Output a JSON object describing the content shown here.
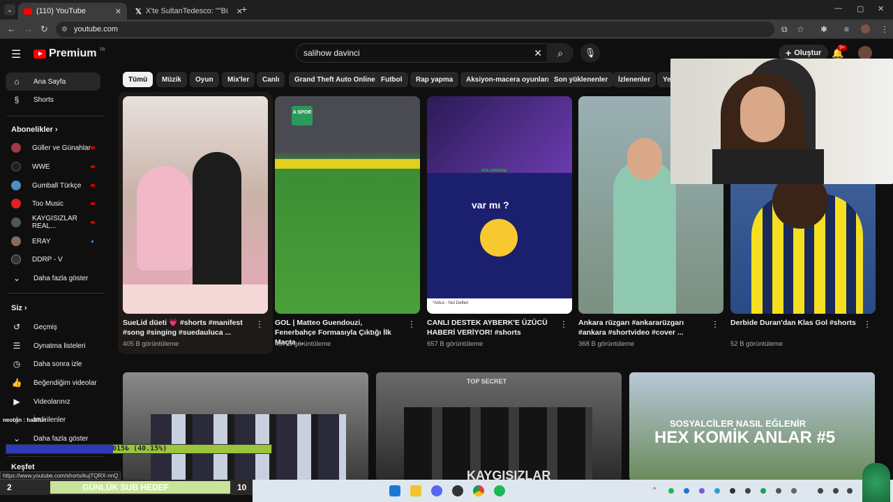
{
  "browser": {
    "tabs": [
      {
        "title": "(110) YouTube",
        "active": true
      },
      {
        "title": "X'te SultanTedesco: \"\"Bütün Fe",
        "active": false
      }
    ],
    "url": "youtube.com",
    "status_url": "https://www.youtube.com/shorts/kujTQRX-nnQ"
  },
  "header": {
    "brand": "Premium",
    "country": "TR",
    "search_value": "salihow davinci",
    "create_label": "Oluştur",
    "notification_count": "9+"
  },
  "sidebar": {
    "main": [
      {
        "label": "Ana Sayfa",
        "icon": "home-icon",
        "active": true
      },
      {
        "label": "Shorts",
        "icon": "shorts-icon",
        "active": false
      }
    ],
    "subs_heading": "Abonelikler",
    "subs": [
      {
        "label": "Güller ve Günahlar",
        "color": "#a0384a",
        "badge": "live"
      },
      {
        "label": "WWE",
        "color": "#222222",
        "badge": "live"
      },
      {
        "label": "Gumball Türkçe",
        "color": "#4a90c8",
        "badge": "live"
      },
      {
        "label": "Too Music",
        "color": "#e02020",
        "badge": "live"
      },
      {
        "label": "KAYGISIZLAR REAL...",
        "color": "#555555",
        "badge": "live"
      },
      {
        "label": "ERAY",
        "color": "#8a6a5a",
        "badge": "new"
      },
      {
        "label": "DDRP - V",
        "color": "#333333",
        "badge": ""
      }
    ],
    "show_more": "Daha fazla göster",
    "you_heading": "Siz",
    "you": [
      {
        "label": "Geçmiş",
        "icon": "history-icon"
      },
      {
        "label": "Oynatma listeleri",
        "icon": "playlist-icon"
      },
      {
        "label": "Daha sonra izle",
        "icon": "watch-later-icon"
      },
      {
        "label": "Beğendiğim videolar",
        "icon": "like-icon"
      },
      {
        "label": "Videolarınız",
        "icon": "your-videos-icon"
      },
      {
        "label": "İndirilenler",
        "icon": "download-icon"
      }
    ],
    "show_more_2": "Daha fazla göster",
    "explore_heading": "Keşfet"
  },
  "chips": [
    "Tümü",
    "Müzik",
    "Oyun",
    "Mix'ler",
    "Canlı",
    "Grand Theft Auto Online",
    "Futbol",
    "Rap yapma",
    "Aksiyon-macera oyunları",
    "Son yüklenenler",
    "İzlenenler",
    "Ye"
  ],
  "videos": [
    {
      "title": "SueLid düeti 💗 #shorts #manifest #song #singing #suedauluca ...",
      "views": "405 B görüntüleme",
      "bg": "#c9b3a8"
    },
    {
      "title": "GOL | Matteo Guendouzi, Fenerbahçe Formasıyla Çıktığı İlk Maçta ...",
      "views": "457 B görüntüleme",
      "bg": "#3d7a34"
    },
    {
      "title": "CANLI DESTEK AYBERK'E ÜZÜCÜ HABERİ VERİYOR! #shorts",
      "views": "657 B görüntüleme",
      "bg": "#1a1f6e"
    },
    {
      "title": "Ankara rüzgarı #ankararüzgarı #ankara #shortvideo #cover ...",
      "views": "368 B görüntüleme",
      "bg": "#8fa3a6"
    },
    {
      "title": "Derbide Duran'dan Klas Gol #shorts",
      "views": "52 B görüntüleme",
      "bg": "#2a4a86"
    }
  ],
  "thumb_texts": {
    "v3_caption": "var mı ?",
    "v3_window": "*Adsız - Not Defteri",
    "v3_link": "kick.com/eray",
    "v2_logo": "A SPOR",
    "w2_text": "KAYGISIZLAR",
    "w2_sign": "TOP SECRET",
    "w3_line1": "SOSYALCİLER NASIL EĞLENİR",
    "w3_line2": "HEX KOMİK ANLAR #5"
  },
  "overlay": {
    "chat_user": "neotrin : halilfun",
    "progress_text": "015₺ (40.15%)",
    "progress_fraction": 0.4015,
    "goal_left": "2",
    "goal_label": "GÜNLÜK SUB HEDEF",
    "goal_right": "10"
  }
}
